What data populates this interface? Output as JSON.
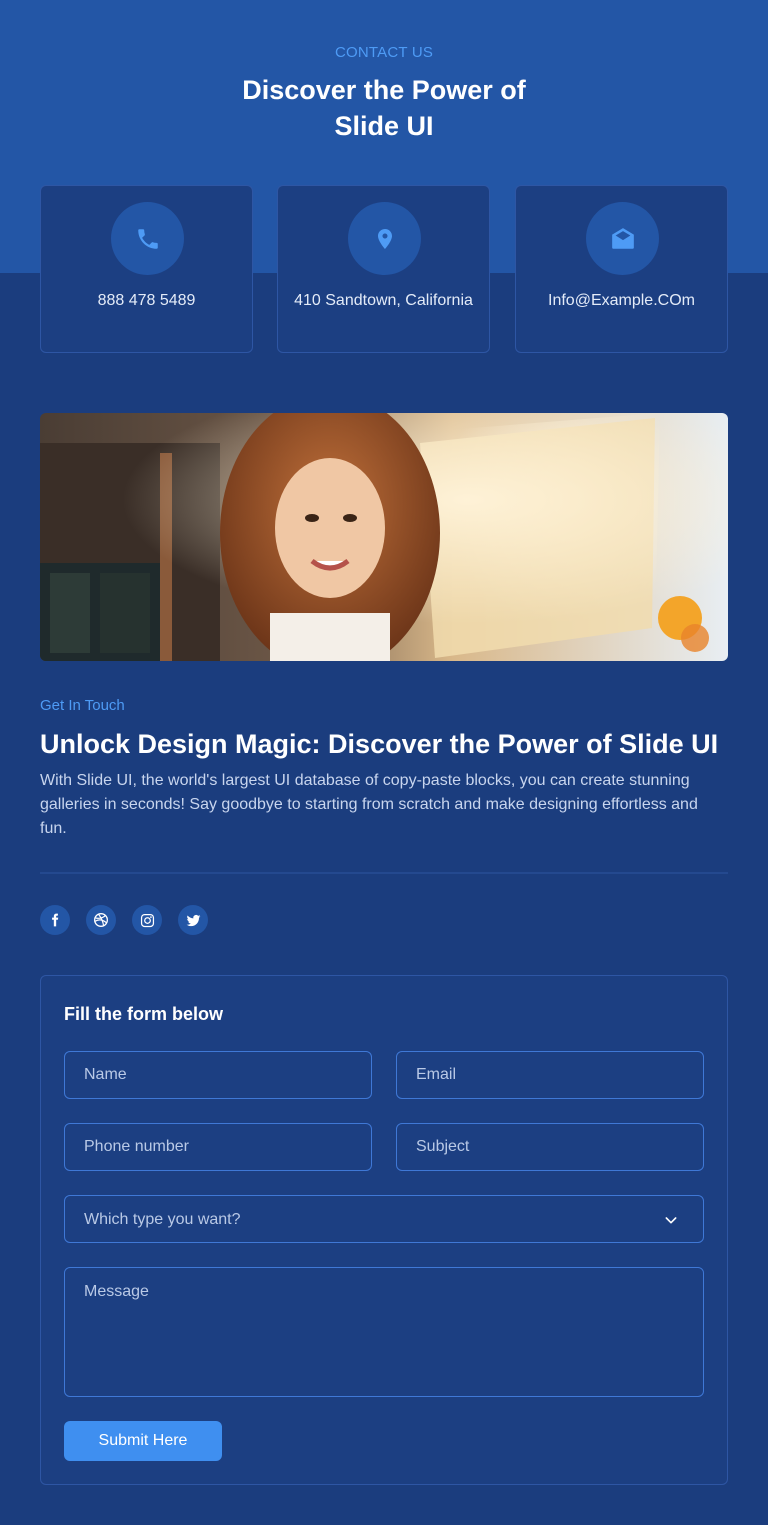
{
  "header": {
    "eyebrow": "CONTACT US",
    "title": "Discover the Power of Slide UI"
  },
  "contact_cards": [
    {
      "icon": "phone-icon",
      "text": "888 478 5489"
    },
    {
      "icon": "location-pin-icon",
      "text": "410 Sandtown, California"
    },
    {
      "icon": "mail-open-icon",
      "text": "Info@Example.COm"
    }
  ],
  "hero_image": {
    "subject": "photo-of-smiling-woman"
  },
  "about": {
    "kicker": "Get In Touch",
    "title": "Unlock Design Magic: Discover the Power of Slide UI",
    "body": "With Slide UI, the world's largest UI database of copy-paste blocks, you can create stunning galleries in seconds! Say goodbye to starting from scratch and make designing effortless and fun."
  },
  "socials": [
    "facebook-icon",
    "dribbble-icon",
    "instagram-icon",
    "twitter-icon"
  ],
  "form": {
    "title": "Fill the form below",
    "name_placeholder": "Name",
    "email_placeholder": "Email",
    "phone_placeholder": "Phone number",
    "subject_placeholder": "Subject",
    "type_selected": "Which type you want?",
    "message_placeholder": "Message",
    "submit_label": "Submit Here"
  },
  "colors": {
    "page_background": "#1b3d7e",
    "hero_band": "#2356a6",
    "accent": "#4e9bf5",
    "button": "#3f8ff0"
  }
}
